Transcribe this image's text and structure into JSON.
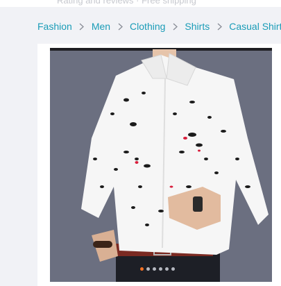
{
  "header": {
    "cut_text": "Rating and reviews · Free shipping"
  },
  "breadcrumb": {
    "items": [
      {
        "label": "Fashion"
      },
      {
        "label": "Men"
      },
      {
        "label": "Clothing"
      },
      {
        "label": "Shirts"
      },
      {
        "label": "Casual Shirts"
      }
    ]
  },
  "gallery": {
    "image_count": 6,
    "active_index": 0,
    "colors": {
      "background": "#6b6f80",
      "shirt": "#f6f6f6",
      "accent_red": "#d81e3c",
      "active_dot": "#f57224"
    }
  }
}
